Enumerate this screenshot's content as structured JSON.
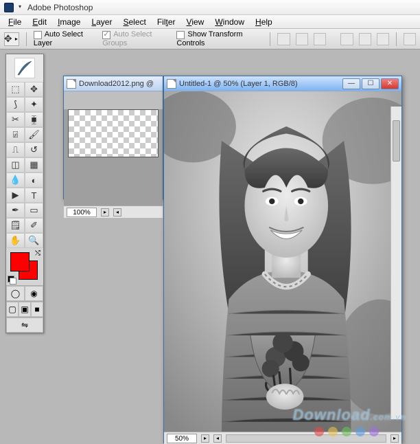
{
  "app": {
    "title": "Adobe Photoshop"
  },
  "menu": {
    "items": [
      "File",
      "Edit",
      "Image",
      "Layer",
      "Select",
      "Filter",
      "View",
      "Window",
      "Help"
    ]
  },
  "optionsbar": {
    "auto_select_layer": "Auto Select Layer",
    "auto_select_groups": "Auto Select Groups",
    "show_transform": "Show Transform Controls"
  },
  "toolbox": {
    "tools": [
      "rectangular-marquee",
      "move",
      "lasso",
      "magic-wand",
      "crop",
      "slice",
      "healing-brush",
      "brush",
      "clone-stamp",
      "history-brush",
      "eraser",
      "gradient",
      "blur",
      "dodge",
      "path-selection",
      "type",
      "pen",
      "rectangle",
      "notes",
      "eyedropper",
      "hand",
      "zoom"
    ],
    "modes": [
      "standard",
      "quickmask"
    ],
    "screens": [
      "standard-screen",
      "full-menubar",
      "full-screen"
    ],
    "jump": [
      "jump-imageready"
    ]
  },
  "documents": {
    "back": {
      "title": "Download2012.png @",
      "zoom": "100%"
    },
    "front": {
      "title": "Untitled-1 @ 50% (Layer 1, RGB/8)",
      "zoom": "50%"
    }
  },
  "watermark": {
    "text": "Download",
    "suffix": ".com.vn"
  },
  "colors": {
    "dot1": "#e24a4a",
    "dot2": "#e8c34a",
    "dot3": "#6abf5a",
    "dot4": "#5a9fe0",
    "dot5": "#9f6fe0"
  }
}
